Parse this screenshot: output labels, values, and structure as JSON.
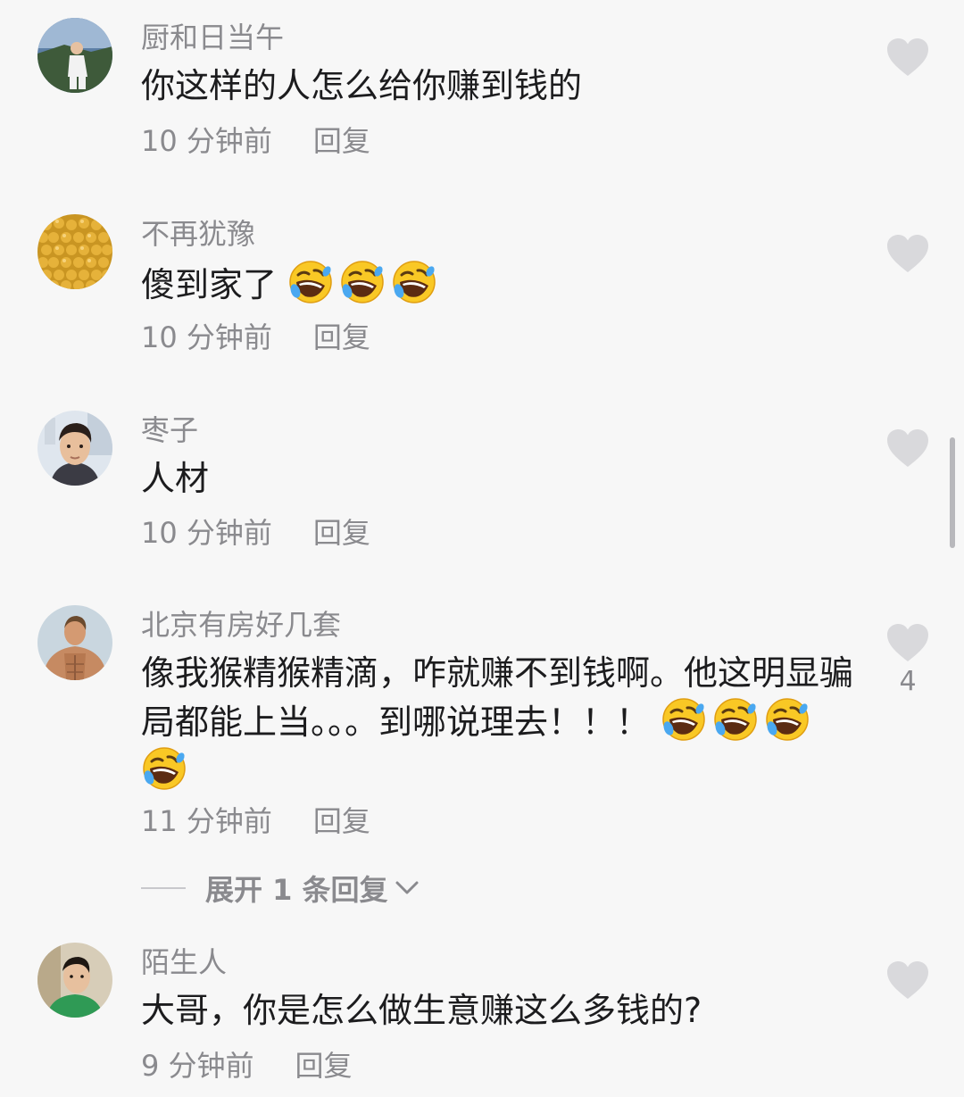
{
  "comments": [
    {
      "username": "厨和日当午",
      "text": "你这样的人怎么给你赚到钱的",
      "time": "10 分钟前",
      "reply_label": "回复",
      "avatar_icon": "avatar-suit-man-photo"
    },
    {
      "username": "不再犹豫",
      "text": "傻到家了",
      "emojis": [
        "rofl",
        "rofl",
        "rofl"
      ],
      "time": "10 分钟前",
      "reply_label": "回复",
      "avatar_icon": "avatar-golden-beads-photo"
    },
    {
      "username": "枣子",
      "text": "人材",
      "time": "10 分钟前",
      "reply_label": "回复",
      "avatar_icon": "avatar-man-selfie-photo"
    },
    {
      "username": "北京有房好几套",
      "text": "像我猴精猴精滴，咋就赚不到钱啊。他这明显骗局都能上当。。。到哪说理去！！！",
      "emojis": [
        "rofl",
        "rofl",
        "rofl",
        "rofl"
      ],
      "time": "11 分钟前",
      "reply_label": "回复",
      "like_count": "4",
      "avatar_icon": "avatar-muscle-man-photo"
    },
    {
      "username": "陌生人",
      "text": "大哥，你是怎么做生意赚这么多钱的?",
      "time": "9 分钟前",
      "reply_label": "回复",
      "avatar_icon": "avatar-man-green-shirt-photo"
    }
  ],
  "expand_replies": {
    "label": "展开 1 条回复"
  },
  "colors": {
    "background": "#f7f7f7",
    "text_primary": "#1c1c1e",
    "text_secondary": "#8a8a8e",
    "heart": "#d9d9dc"
  }
}
